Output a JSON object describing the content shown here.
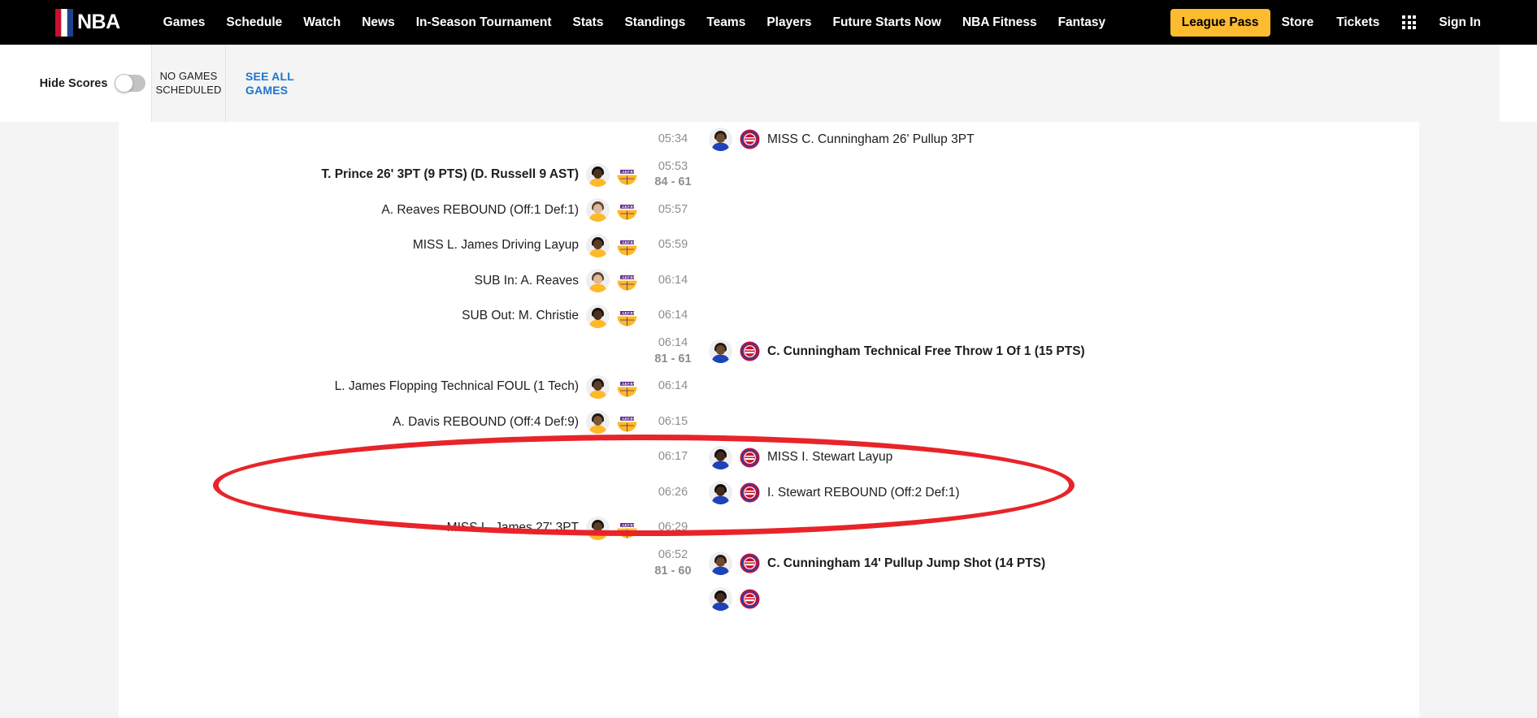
{
  "nav": {
    "brand": "NBA",
    "links": [
      "Games",
      "Schedule",
      "Watch",
      "News",
      "In-Season Tournament",
      "Stats",
      "Standings",
      "Teams",
      "Players",
      "Future Starts Now",
      "NBA Fitness",
      "Fantasy"
    ],
    "league_pass": "League Pass",
    "right_links": [
      "Store",
      "Tickets"
    ],
    "sign_in": "Sign In",
    "accent_color": "#fdbb30",
    "bar_color": "#000000"
  },
  "subheader": {
    "hide_scores_label": "Hide Scores",
    "hide_scores_on": false,
    "no_games_line1": "NO GAMES",
    "no_games_line2": "SCHEDULED",
    "see_all_line1": "SEE ALL",
    "see_all_line2": "GAMES",
    "link_color": "#1d74cf"
  },
  "annotation": {
    "shape": "ellipse",
    "color": "#e8242a",
    "target_text": "C. Cunningham Technical Free Throw 1 Of 1 (15 PTS)"
  },
  "teams": {
    "lakers": {
      "abbr": "LAL",
      "name": "Lakers",
      "primary": "#552583",
      "secondary": "#fdb927"
    },
    "pistons": {
      "abbr": "DET",
      "name": "Pistons",
      "primary": "#c8102e",
      "secondary": "#1d42ba"
    }
  },
  "plays": [
    {
      "side": "right",
      "team": "pistons",
      "time": "05:34",
      "score": "",
      "text": "MISS C. Cunningham 26' Pullup 3PT",
      "bold": false,
      "skin": "#6b4a32",
      "hair": "#241812",
      "jersey": "#1d42ba"
    },
    {
      "side": "left",
      "team": "lakers",
      "time": "05:53",
      "score": "84 - 61",
      "text": "T. Prince 26' 3PT (9 PTS) (D. Russell 9 AST)",
      "bold": true,
      "skin": "#4a3121",
      "hair": "#120c08",
      "jersey": "#fdb927"
    },
    {
      "side": "left",
      "team": "lakers",
      "time": "05:57",
      "score": "",
      "text": "A. Reaves REBOUND (Off:1 Def:1)",
      "bold": false,
      "skin": "#e0b895",
      "hair": "#5e4630",
      "jersey": "#fdb927"
    },
    {
      "side": "left",
      "team": "lakers",
      "time": "05:59",
      "score": "",
      "text": "MISS L. James Driving Layup",
      "bold": false,
      "skin": "#5c3d27",
      "hair": "#1a1210",
      "jersey": "#fdb927"
    },
    {
      "side": "left",
      "team": "lakers",
      "time": "06:14",
      "score": "",
      "text": "SUB In: A. Reaves",
      "bold": false,
      "skin": "#e0b895",
      "hair": "#5e4630",
      "jersey": "#fdb927"
    },
    {
      "side": "left",
      "team": "lakers",
      "time": "06:14",
      "score": "",
      "text": "SUB Out: M. Christie",
      "bold": false,
      "skin": "#4e3220",
      "hair": "#17100c",
      "jersey": "#fdb927"
    },
    {
      "side": "right",
      "team": "pistons",
      "time": "06:14",
      "score": "81 - 61",
      "text": "C. Cunningham Technical Free Throw 1 Of 1 (15 PTS)",
      "bold": true,
      "skin": "#6b4a32",
      "hair": "#241812",
      "jersey": "#1d42ba"
    },
    {
      "side": "left",
      "team": "lakers",
      "time": "06:14",
      "score": "",
      "text": "L. James Flopping Technical FOUL (1 Tech)",
      "bold": false,
      "skin": "#5c3d27",
      "hair": "#1a1210",
      "jersey": "#fdb927"
    },
    {
      "side": "left",
      "team": "lakers",
      "time": "06:15",
      "score": "",
      "text": "A. Davis REBOUND (Off:4 Def:9)",
      "bold": false,
      "skin": "#7d5636",
      "hair": "#1f1712",
      "jersey": "#fdb927"
    },
    {
      "side": "right",
      "team": "pistons",
      "time": "06:17",
      "score": "",
      "text": "MISS I. Stewart Layup",
      "bold": false,
      "skin": "#44291b",
      "hair": "#110b08",
      "jersey": "#1d42ba"
    },
    {
      "side": "right",
      "team": "pistons",
      "time": "06:26",
      "score": "",
      "text": "I. Stewart REBOUND (Off:2 Def:1)",
      "bold": false,
      "skin": "#44291b",
      "hair": "#110b08",
      "jersey": "#1d42ba"
    },
    {
      "side": "left",
      "team": "lakers",
      "time": "06:29",
      "score": "",
      "text": "MISS L. James 27' 3PT",
      "bold": false,
      "skin": "#5c3d27",
      "hair": "#1a1210",
      "jersey": "#fdb927"
    },
    {
      "side": "right",
      "team": "pistons",
      "time": "06:52",
      "score": "81 - 60",
      "text": "C. Cunningham 14' Pullup Jump Shot (14 PTS)",
      "bold": true,
      "skin": "#6b4a32",
      "hair": "#241812",
      "jersey": "#1d42ba"
    },
    {
      "side": "right",
      "team": "pistons",
      "time": "",
      "score": "",
      "text": "",
      "bold": false,
      "skin": "#44291b",
      "hair": "#110b08",
      "jersey": "#1d42ba"
    }
  ]
}
